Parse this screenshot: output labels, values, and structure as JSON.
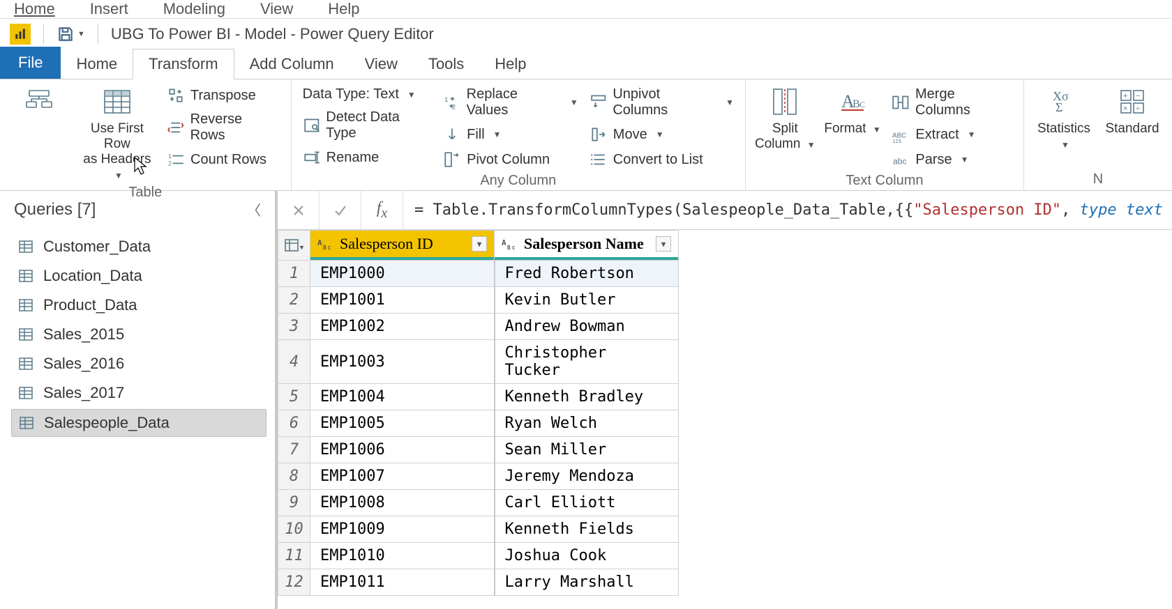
{
  "appMenu": [
    "Home",
    "Insert",
    "Modeling",
    "View",
    "Help"
  ],
  "appMenuActive": 0,
  "title": "UBG To Power BI - Model - Power Query Editor",
  "ribbonTabs": {
    "file": "File",
    "items": [
      "Home",
      "Transform",
      "Add Column",
      "View",
      "Tools",
      "Help"
    ],
    "active": 1
  },
  "ribbon": {
    "tableGroup": {
      "label": "Table",
      "groupBy": "Group\nBy",
      "useFirstRow": "Use First Row\nas Headers",
      "transpose": "Transpose",
      "reverseRows": "Reverse Rows",
      "countRows": "Count Rows"
    },
    "anyColumnGroup": {
      "label": "Any Column",
      "dataType": "Data Type: Text",
      "detect": "Detect Data Type",
      "rename": "Rename",
      "replace": "Replace Values",
      "fill": "Fill",
      "pivot": "Pivot Column",
      "unpivot": "Unpivot Columns",
      "move": "Move",
      "convert": "Convert to List"
    },
    "textColumnGroup": {
      "label": "Text Column",
      "split": "Split\nColumn",
      "format": "Format",
      "merge": "Merge Columns",
      "extract": "Extract",
      "parse": "Parse"
    },
    "numberGroup": {
      "label": "N",
      "statistics": "Statistics",
      "standard": "Standard"
    }
  },
  "queriesHeader": "Queries [7]",
  "queries": [
    "Customer_Data",
    "Location_Data",
    "Product_Data",
    "Sales_2015",
    "Sales_2016",
    "Sales_2017",
    "Salespeople_Data"
  ],
  "selectedQuery": 6,
  "formula": {
    "prefix": "= Table.TransformColumnTypes(Salespeople_Data_Table,{{",
    "string": "\"Salesperson ID\"",
    "mid": ", ",
    "kw": "type text"
  },
  "tableHeaders": [
    "Salesperson ID",
    "Salesperson Name"
  ],
  "tableData": [
    {
      "id": "EMP1000",
      "name": "Fred Robertson"
    },
    {
      "id": "EMP1001",
      "name": "Kevin Butler"
    },
    {
      "id": "EMP1002",
      "name": "Andrew Bowman"
    },
    {
      "id": "EMP1003",
      "name": "Christopher Tucker"
    },
    {
      "id": "EMP1004",
      "name": "Kenneth Bradley"
    },
    {
      "id": "EMP1005",
      "name": "Ryan Welch"
    },
    {
      "id": "EMP1006",
      "name": "Sean Miller"
    },
    {
      "id": "EMP1007",
      "name": "Jeremy Mendoza"
    },
    {
      "id": "EMP1008",
      "name": "Carl Elliott"
    },
    {
      "id": "EMP1009",
      "name": "Kenneth Fields"
    },
    {
      "id": "EMP1010",
      "name": "Joshua Cook"
    },
    {
      "id": "EMP1011",
      "name": "Larry Marshall"
    }
  ]
}
